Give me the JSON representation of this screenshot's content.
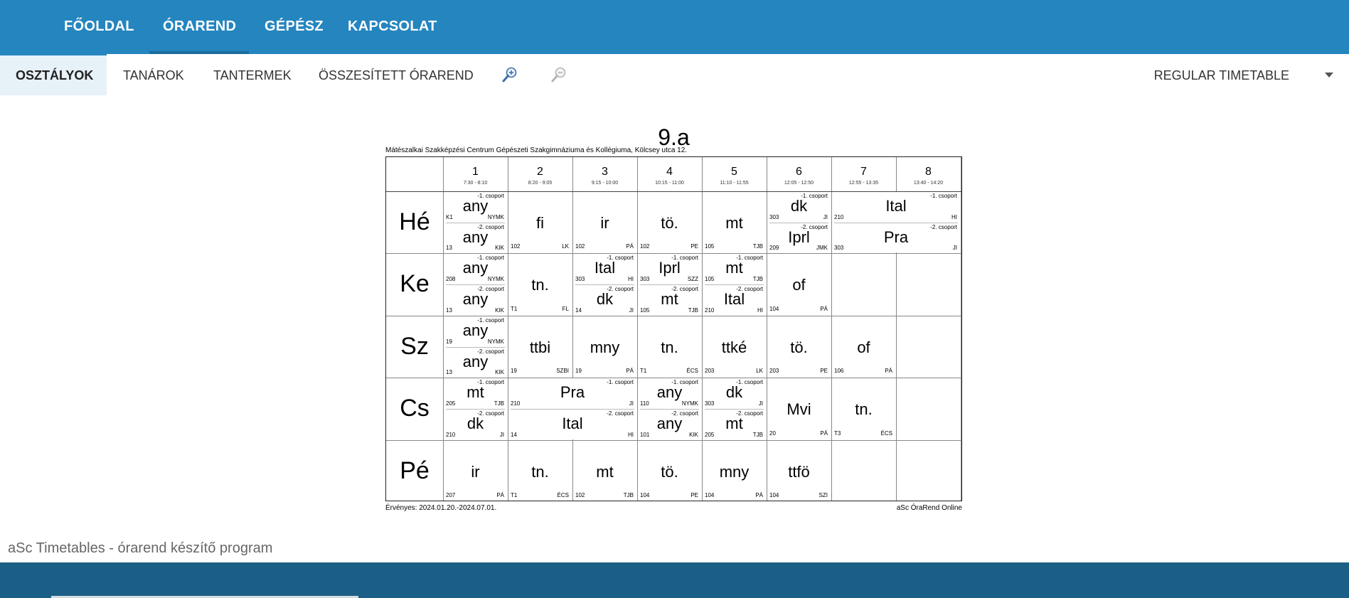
{
  "nav": {
    "items": [
      "FŐOLDAL",
      "ÓRAREND",
      "GÉPÉSZ",
      "KAPCSOLAT"
    ],
    "active": "ÓRAREND"
  },
  "subnav": {
    "items": [
      "OSZTÁLYOK",
      "TANÁROK",
      "TANTERMEK",
      "ÖSSZESÍTETT ÓRAREND"
    ],
    "active": "OSZTÁLYOK",
    "timetable_select": "REGULAR TIMETABLE",
    "zoom_in_icon": "zoom-in-icon",
    "zoom_out_icon": "zoom-out-icon"
  },
  "timetable": {
    "title": "9.a",
    "school": "Mátészalkai Szakképzési Centrum Gépészeti Szakgimnáziuma és Kollégiuma, Kölcsey utca 12.",
    "valid": "Érvényes: 2024.01.20.-2024.07.01.",
    "brand": "aSc ÓraRend Online",
    "periods": [
      {
        "num": "1",
        "time": "7:30 - 8:10"
      },
      {
        "num": "2",
        "time": "8:20 - 9:05"
      },
      {
        "num": "3",
        "time": "9:15 - 10:00"
      },
      {
        "num": "4",
        "time": "10:15 - 11:00"
      },
      {
        "num": "5",
        "time": "11:10 - 11:55"
      },
      {
        "num": "6",
        "time": "12:05 - 12:50"
      },
      {
        "num": "7",
        "time": "12:55 - 13:35"
      },
      {
        "num": "8",
        "time": "13:40 - 14:20"
      }
    ],
    "days": [
      {
        "name": "Hé",
        "cells": [
          {
            "split": true,
            "top": {
              "subj": "any",
              "group": "-1. csoport",
              "room": "K1",
              "teacher": "NYMK"
            },
            "bottom": {
              "subj": "any",
              "group": "-2. csoport",
              "room": "13",
              "teacher": "KIK"
            }
          },
          {
            "subj": "fi",
            "room": "102",
            "teacher": "LK"
          },
          {
            "subj": "ir",
            "room": "102",
            "teacher": "PÁ"
          },
          {
            "subj": "tö.",
            "room": "102",
            "teacher": "PE"
          },
          {
            "subj": "mt",
            "room": "105",
            "teacher": "TJB"
          },
          {
            "split": true,
            "top": {
              "subj": "dk",
              "group": "-1. csoport",
              "room": "303",
              "teacher": "JI"
            },
            "bottom": {
              "subj": "Iprl",
              "group": "-2. csoport",
              "room": "209",
              "teacher": "JMK"
            }
          },
          {
            "split": true,
            "span": 2,
            "top": {
              "subj": "Ital",
              "group": "-1. csoport",
              "room": "210",
              "teacher": "HI"
            },
            "bottom": {
              "subj": "Pra",
              "group": "-2. csoport",
              "room": "303",
              "teacher": "JI"
            }
          }
        ]
      },
      {
        "name": "Ke",
        "cells": [
          {
            "split": true,
            "top": {
              "subj": "any",
              "group": "-1. csoport",
              "room": "208",
              "teacher": "NYMK"
            },
            "bottom": {
              "subj": "any",
              "group": "-2. csoport",
              "room": "13",
              "teacher": "KIK"
            }
          },
          {
            "subj": "tn.",
            "room": "T1",
            "teacher": "FL"
          },
          {
            "split": true,
            "top": {
              "subj": "Ital",
              "group": "-1. csoport",
              "room": "303",
              "teacher": "HI"
            },
            "bottom": {
              "subj": "dk",
              "group": "-2. csoport",
              "room": "14",
              "teacher": "JI"
            }
          },
          {
            "split": true,
            "top": {
              "subj": "Iprl",
              "group": "-1. csoport",
              "room": "303",
              "teacher": "SZZ"
            },
            "bottom": {
              "subj": "mt",
              "group": "-2. csoport",
              "room": "105",
              "teacher": "TJB"
            }
          },
          {
            "split": true,
            "top": {
              "subj": "mt",
              "group": "-1. csoport",
              "room": "105",
              "teacher": "TJB"
            },
            "bottom": {
              "subj": "Ital",
              "group": "-2. csoport",
              "room": "210",
              "teacher": "HI"
            }
          },
          {
            "subj": "of",
            "room": "104",
            "teacher": "PÁ"
          },
          {
            "empty": true
          },
          {
            "empty": true
          }
        ]
      },
      {
        "name": "Sz",
        "cells": [
          {
            "split": true,
            "top": {
              "subj": "any",
              "group": "-1. csoport",
              "room": "19",
              "teacher": "NYMK"
            },
            "bottom": {
              "subj": "any",
              "group": "-2. csoport",
              "room": "13",
              "teacher": "KIK"
            }
          },
          {
            "subj": "ttbi",
            "room": "19",
            "teacher": "SZBI"
          },
          {
            "subj": "mny",
            "room": "19",
            "teacher": "PÁ"
          },
          {
            "subj": "tn.",
            "room": "T1",
            "teacher": "ÉCS"
          },
          {
            "subj": "ttké",
            "room": "203",
            "teacher": "LK"
          },
          {
            "subj": "tö.",
            "room": "203",
            "teacher": "PE"
          },
          {
            "subj": "of",
            "room": "106",
            "teacher": "PÁ"
          },
          {
            "empty": true
          }
        ]
      },
      {
        "name": "Cs",
        "cells": [
          {
            "split": true,
            "top": {
              "subj": "mt",
              "group": "-1. csoport",
              "room": "205",
              "teacher": "TJB"
            },
            "bottom": {
              "subj": "dk",
              "group": "-2. csoport",
              "room": "210",
              "teacher": "JI"
            }
          },
          {
            "split": true,
            "span": 2,
            "top": {
              "subj": "Pra",
              "group": "-1. csoport",
              "room": "210",
              "teacher": "JI"
            },
            "bottom": {
              "subj": "Ital",
              "group": "-2. csoport",
              "room": "14",
              "teacher": "HI"
            }
          },
          {
            "split": true,
            "top": {
              "subj": "any",
              "group": "-1. csoport",
              "room": "110",
              "teacher": "NYMK"
            },
            "bottom": {
              "subj": "any",
              "group": "-2. csoport",
              "room": "101",
              "teacher": "KIK"
            }
          },
          {
            "split": true,
            "top": {
              "subj": "dk",
              "group": "-1. csoport",
              "room": "303",
              "teacher": "JI"
            },
            "bottom": {
              "subj": "mt",
              "group": "-2. csoport",
              "room": "205",
              "teacher": "TJB"
            }
          },
          {
            "subj": "Mvi",
            "room": "20",
            "teacher": "PÁ"
          },
          {
            "subj": "tn.",
            "room": "T3",
            "teacher": "ÉCS"
          },
          {
            "empty": true
          }
        ]
      },
      {
        "name": "Pé",
        "cells": [
          {
            "subj": "ir",
            "room": "207",
            "teacher": "PÁ"
          },
          {
            "subj": "tn.",
            "room": "T1",
            "teacher": "ÉCS"
          },
          {
            "subj": "mt",
            "room": "102",
            "teacher": "TJB"
          },
          {
            "subj": "tö.",
            "room": "104",
            "teacher": "PE"
          },
          {
            "subj": "mny",
            "room": "104",
            "teacher": "PÁ"
          },
          {
            "subj": "ttfö",
            "room": "104",
            "teacher": "SZI"
          },
          {
            "empty": true
          },
          {
            "empty": true
          }
        ]
      }
    ]
  },
  "status_text": "aSc Timetables - órarend készítő program"
}
